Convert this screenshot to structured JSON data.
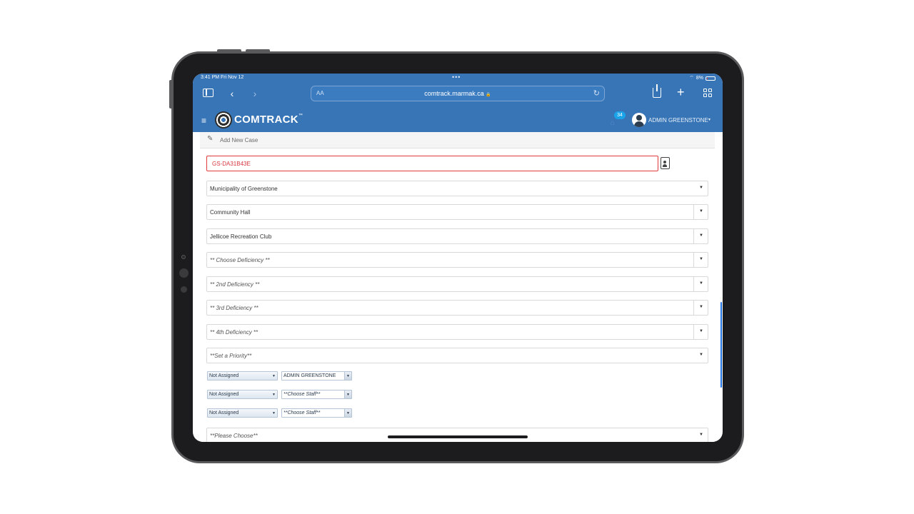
{
  "status_bar": {
    "time": "3:41 PM  Fri Nov 12",
    "dots": "•••",
    "battery": "8%"
  },
  "browser": {
    "text_size_label": "AA",
    "url": "comtrack.marmak.ca",
    "lock_glyph": "🔒",
    "reload_glyph": "↻",
    "back_glyph": "‹",
    "forward_glyph": "›",
    "plus_glyph": "+"
  },
  "app": {
    "menu_glyph": "≡",
    "brand": "COMTRACK",
    "brand_tm": "™",
    "notification_count": "34",
    "user_name": "ADMIN GREENSTONE",
    "user_caret": "▾"
  },
  "panel": {
    "title": "Add New Case",
    "pencil_glyph": "✎"
  },
  "form": {
    "case_id": "GS-DA31B43E",
    "municipality": "Municipality of Greenstone",
    "facility": "Community Hall",
    "location": "Jellicoe Recreation Club",
    "deficiency_1": "** Choose Deficiency **",
    "deficiency_2": "** 2nd Deficiency **",
    "deficiency_3": "** 3rd Deficiency **",
    "deficiency_4": "** 4th Deficiency **",
    "priority": "**Set a Priority**",
    "assignments": [
      {
        "status": "Not Assigned",
        "staff": "ADMIN GREENSTONE"
      },
      {
        "status": "Not Assigned",
        "staff": "**Choose Staff**"
      },
      {
        "status": "Not Assigned",
        "staff": "**Choose Staff**"
      }
    ],
    "please_choose": "**Please Choose**",
    "caret": "▼"
  },
  "colors": {
    "brand_blue": "#3775b7",
    "error_red": "#e23b3b",
    "badge_blue": "#1aa3e8"
  }
}
